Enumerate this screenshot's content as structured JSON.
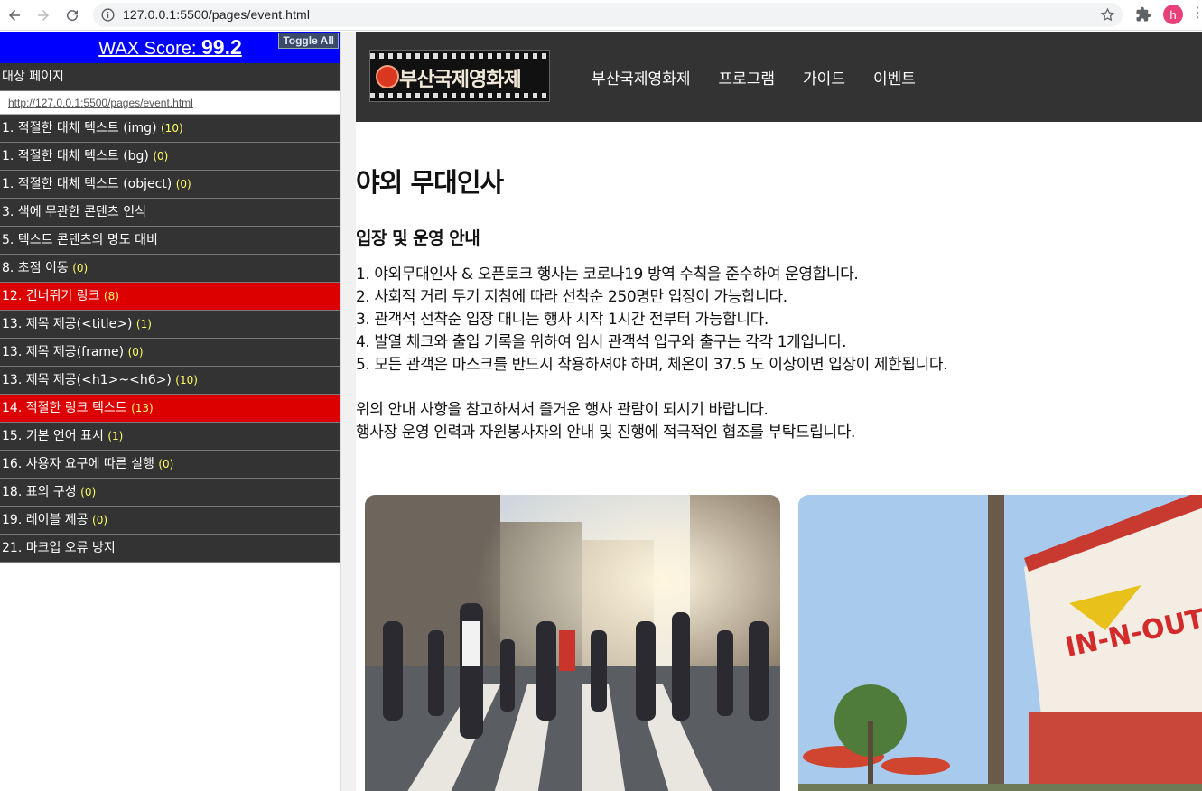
{
  "browser": {
    "url": "127.0.0.1:5500/pages/event.html",
    "profile_initial": "h"
  },
  "wax": {
    "score_label": "WAX Score:",
    "score_value": "99.2",
    "toggle_label": "Toggle All",
    "target_label": "대상 페이지",
    "target_url": "http://127.0.0.1:5500/pages/event.html",
    "items": [
      {
        "label": "1. 적절한 대체 텍스트 (img)",
        "count": "(10)",
        "error": false
      },
      {
        "label": "1. 적절한 대체 텍스트 (bg)",
        "count": "(0)",
        "error": false
      },
      {
        "label": "1. 적절한 대체 텍스트 (object)",
        "count": "(0)",
        "error": false
      },
      {
        "label": "3. 색에 무관한 콘텐츠 인식",
        "count": "",
        "error": false
      },
      {
        "label": "5. 텍스트 콘텐츠의 명도 대비",
        "count": "",
        "error": false
      },
      {
        "label": "8. 초점 이동",
        "count": "(0)",
        "error": false
      },
      {
        "label": "12. 건너뛰기 링크",
        "count": "(8)",
        "error": true
      },
      {
        "label": "13. 제목 제공(<title>)",
        "count": "(1)",
        "error": false
      },
      {
        "label": "13. 제목 제공(frame)",
        "count": "(0)",
        "error": false
      },
      {
        "label": "13. 제목 제공(<h1>~<h6>)",
        "count": "(10)",
        "error": false
      },
      {
        "label": "14. 적절한 링크 텍스트",
        "count": "(13)",
        "error": true
      },
      {
        "label": "15. 기본 언어 표시",
        "count": "(1)",
        "error": false
      },
      {
        "label": "16. 사용자 요구에 따른 실행",
        "count": "(0)",
        "error": false
      },
      {
        "label": "18. 표의 구성",
        "count": "(0)",
        "error": false
      },
      {
        "label": "19. 레이블 제공",
        "count": "(0)",
        "error": false
      },
      {
        "label": "21. 마크업 오류 방지",
        "count": "",
        "error": false
      }
    ]
  },
  "site": {
    "logo_text": "부산국제영화제",
    "nav": [
      "부산국제영화제",
      "프로그램",
      "가이드",
      "이벤트"
    ]
  },
  "main": {
    "title": "야외 무대인사",
    "subtitle": "입장 및 운영 안내",
    "rules": [
      "1. 야외무대인사 & 오픈토크 행사는 코로나19 방역 수칙을 준수하여 운영합니다.",
      "2. 사회적 거리 두기 지침에 따라 선착순 250명만 입장이 가능합니다.",
      "3. 관객석 선착순 입장 대니는 행사 시작 1시간 전부터 가능합니다.",
      "4. 발열 체크와 출입 기록을 위하여 임시 관객석 입구와 출구는 각각 1개입니다.",
      "5. 모든 관객은 마스크를 반드시 착용하셔야 하며, 체온이 37.5 도 이상이면 입장이 제한됩니다."
    ],
    "notice": [
      "위의 안내 사항을 참고하셔서 즐거운 행사 관람이 되시기 바랍니다.",
      "행사장 운영 인력과 자원봉사자의 안내 및 진행에 적극적인 협조를 부탁드립니다."
    ],
    "photo2_sign": "IN-N-OUT"
  }
}
